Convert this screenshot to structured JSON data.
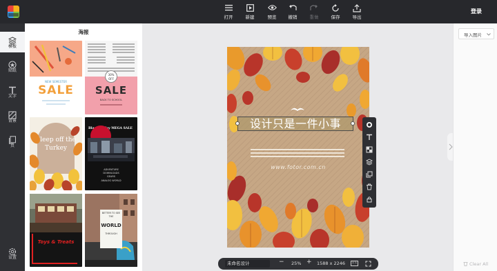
{
  "app": {
    "logo_text": "fotor"
  },
  "toolbar": {
    "items": [
      {
        "label": "打开",
        "icon": "menu-icon"
      },
      {
        "label": "新建",
        "icon": "new-icon"
      },
      {
        "label": "预览",
        "icon": "eye-icon"
      },
      {
        "label": "撤销",
        "icon": "undo-icon"
      },
      {
        "label": "重做",
        "icon": "redo-icon"
      },
      {
        "label": "保存",
        "icon": "save-icon"
      },
      {
        "label": "导出",
        "icon": "export-icon"
      }
    ],
    "login": "登录"
  },
  "rail": {
    "items": [
      {
        "label": "模板",
        "icon": "template-icon"
      },
      {
        "label": "贴纸",
        "icon": "sticker-icon"
      },
      {
        "label": "文字",
        "icon": "text-icon"
      },
      {
        "label": "背景",
        "icon": "background-icon"
      },
      {
        "label": "页",
        "icon": "pages-icon"
      }
    ],
    "settings": "设置"
  },
  "panel": {
    "title": "海报",
    "templates": [
      {
        "title": "SALE",
        "sub": "NEW SEMESTER"
      },
      {
        "title": "SALE",
        "sub": "BACK TO SCHOOL",
        "badge": "30% OFF"
      },
      {
        "title": "Sleep off the Turkey"
      },
      {
        "title": "Black Friday MEGA SALE",
        "sub": "ANALOG WORLD"
      },
      {
        "title": "Toys & Treats"
      },
      {
        "title": "WORLD",
        "top": "BETTER TO SEE THE",
        "bottom": "THROUGH"
      }
    ]
  },
  "poster": {
    "headline": "设计只是一件小事",
    "url": "www.fotor.com.cn"
  },
  "zoombar": {
    "doc_name": "未命名设计",
    "minus": "−",
    "zoom": "25%",
    "plus": "+",
    "size": "1588 x 2246"
  },
  "right_panel": {
    "import": "导入图片",
    "clear": "Clear All"
  }
}
